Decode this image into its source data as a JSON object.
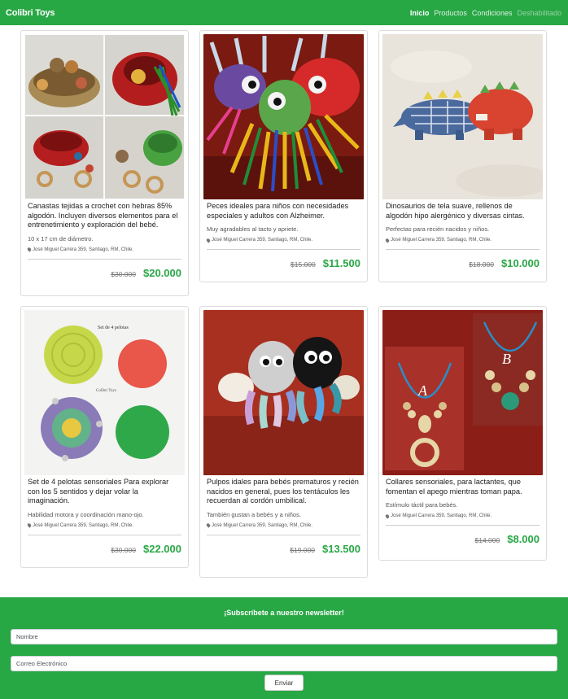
{
  "navbar": {
    "brand": "Colibri Toys",
    "links": [
      "Inicio",
      "Productos",
      "Condiciones",
      "Deshabilitado"
    ]
  },
  "products": [
    {
      "title": "Canastas tejidas a crochet con hebras 85% algodón. Incluyen diversos elementos para el entrenetimiento y exploración del bebé.",
      "text": "10 x 17 cm de diámetro.",
      "location": "José Miguel Carrera 359, Santiago, RM, Chile.",
      "old_price": "$30.000",
      "price": "$20.000"
    },
    {
      "title": "Peces ideales para niños con necesidades especiales y adultos con Alzheimer.",
      "text": "Muy agradables al tacto y apriete.",
      "location": "José Miguel Carrera 359, Santiago, RM, Chile.",
      "old_price": "$15.000",
      "price": "$11.500"
    },
    {
      "title": "Dinosaurios de tela suave, rellenos de algodón hipo alergénico y diversas cintas.",
      "text": "Perfectas para recién nacidos y niños.",
      "location": "José Miguel Carrera 359, Santiago, RM, Chile.",
      "old_price": "$18.000",
      "price": "$10.000"
    },
    {
      "title": "Set de 4 pelotas sensoriales Para explorar con los 5 sentidos y dejar volar la imaginación.",
      "text": "Habilidad motora y coordinación mano-ojo.",
      "location": "José Miguel Carrera 359, Santiago, RM, Chile.",
      "old_price": "$30.000",
      "price": "$22.000",
      "image_labels": [
        "Set de 4 pelotas",
        "Colibri Toys"
      ]
    },
    {
      "title": "Pulpos idales para bebés prematuros y recién nacidos en general, pues los tentáculos les recuerdan al cordón umbilical.",
      "text": "También gustan a bebés y a niños.",
      "location": "José Miguel Carrera 359, Santiago, RM, Chile.",
      "old_price": "$19.000",
      "price": "$13.500"
    },
    {
      "title": "Collares sensoriales, para lactantes, que fomentan el apego mientras toman papa.",
      "text": "Estímulo táctil para bebés.",
      "location": "José Miguel Carrera 359, Santiago, RM, Chile.",
      "old_price": "$14.000",
      "price": "$8.000",
      "image_labels": [
        "A",
        "B"
      ]
    }
  ],
  "newsletter": {
    "title": "¡Subscríbete a nuestro newsletter!",
    "name_placeholder": "Nombre",
    "email_placeholder": "Correo Electrónico",
    "button": "Enviar"
  },
  "colors": {
    "brand_green": "#28a745",
    "price_green": "#28a745"
  }
}
